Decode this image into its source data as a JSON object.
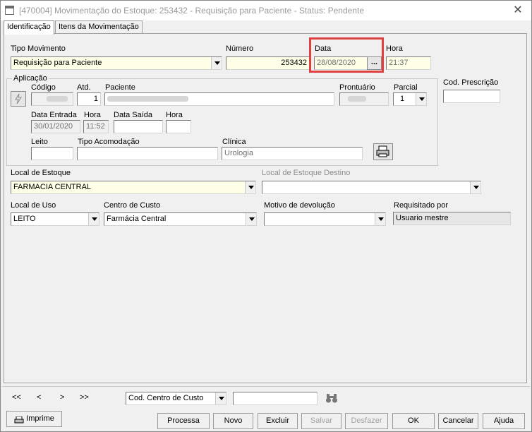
{
  "window": {
    "title": "[470004]  Movimentação do Estoque: 253432 - Requisição para Paciente - Status: Pendente"
  },
  "tabs": [
    {
      "label": "Identificação"
    },
    {
      "label": "Itens da Movimentação"
    }
  ],
  "form": {
    "tipo_movimento": {
      "label": "Tipo Movimento",
      "value": "Requisição para Paciente"
    },
    "numero": {
      "label": "Número",
      "value": "253432"
    },
    "data": {
      "label": "Data",
      "value": "28/08/2020",
      "button": "..."
    },
    "hora": {
      "label": "Hora",
      "value": "21:37"
    },
    "aplicacao": {
      "label": "Aplicação",
      "codigo": {
        "label": "Código"
      },
      "atd": {
        "label": "Atd.",
        "value": "1"
      },
      "paciente": {
        "label": "Paciente"
      },
      "prontuario": {
        "label": "Prontuário"
      },
      "parcial": {
        "label": "Parcial",
        "value": "1"
      },
      "data_entrada": {
        "label": "Data Entrada",
        "value": "30/01/2020"
      },
      "hora_entrada": {
        "label": "Hora",
        "value": "11:52"
      },
      "data_saida": {
        "label": "Data Saída",
        "value": ""
      },
      "hora_saida": {
        "label": "Hora",
        "value": ""
      },
      "leito": {
        "label": "Leito",
        "value": ""
      },
      "tipo_acomodacao": {
        "label": "Tipo Acomodação",
        "value": ""
      },
      "clinica": {
        "label": "Clínica",
        "value": "Urologia"
      }
    },
    "cod_prescricao": {
      "label": "Cod. Prescrição",
      "value": ""
    },
    "local_estoque": {
      "label": "Local de Estoque",
      "value": "FARMACIA CENTRAL"
    },
    "local_estoque_destino": {
      "label": "Local de Estoque Destino",
      "value": ""
    },
    "local_uso": {
      "label": "Local de Uso",
      "value": "LEITO"
    },
    "centro_custo": {
      "label": "Centro de Custo",
      "value": "Farmácia Central"
    },
    "motivo_devolucao": {
      "label": "Motivo de devolução",
      "value": ""
    },
    "requisitado_por": {
      "label": "Requisitado por",
      "value": "Usuario mestre"
    }
  },
  "nav": {
    "first": "<<",
    "prev": "<",
    "next": ">",
    "last": ">>",
    "search_field": "Cod. Centro de Custo",
    "search_value": ""
  },
  "buttons": {
    "imprime": "Imprime",
    "processa": "Processa",
    "novo": "Novo",
    "excluir": "Excluir",
    "salvar": "Salvar",
    "desfazer": "Desfazer",
    "ok": "OK",
    "cancelar": "Cancelar",
    "ajuda": "Ajuda"
  }
}
